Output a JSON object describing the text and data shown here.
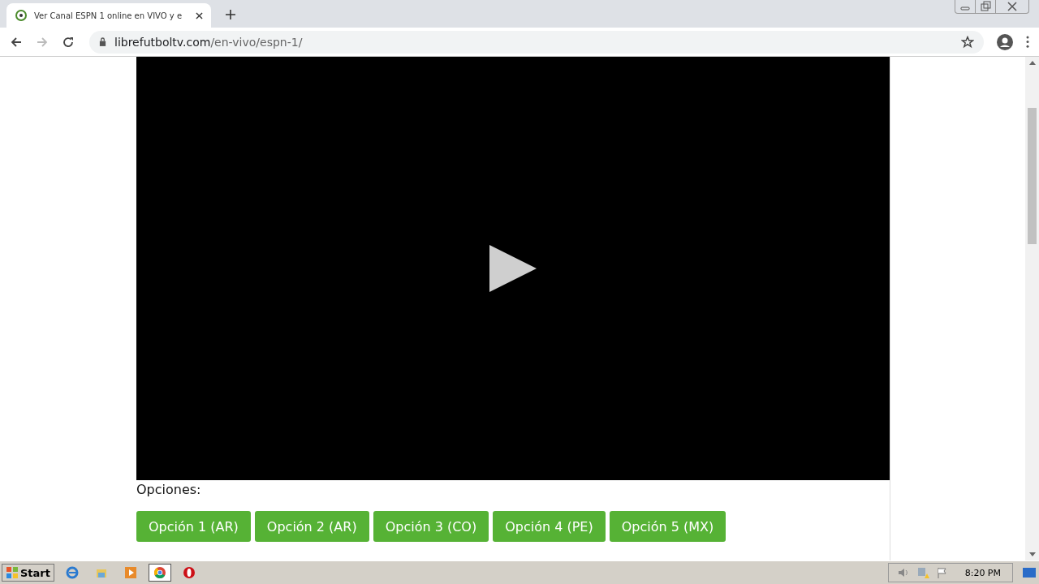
{
  "tab": {
    "title": "Ver Canal ESPN 1 online en VIVO y e"
  },
  "address": {
    "host": "librefutboltv.com",
    "path": "/en-vivo/espn-1/"
  },
  "options": {
    "label": "Opciones:",
    "buttons": [
      "Opción 1 (AR)",
      "Opción 2 (AR)",
      "Opción 3 (CO)",
      "Opción 4 (PE)",
      "Opción 5 (MX)"
    ]
  },
  "taskbar": {
    "start": "Start",
    "apps": [
      {
        "kind": "ie",
        "selected": false
      },
      {
        "kind": "explorer",
        "selected": false
      },
      {
        "kind": "media",
        "selected": false
      },
      {
        "kind": "chrome",
        "selected": true
      },
      {
        "kind": "opera",
        "selected": false
      }
    ],
    "clock": "8:20 PM"
  }
}
